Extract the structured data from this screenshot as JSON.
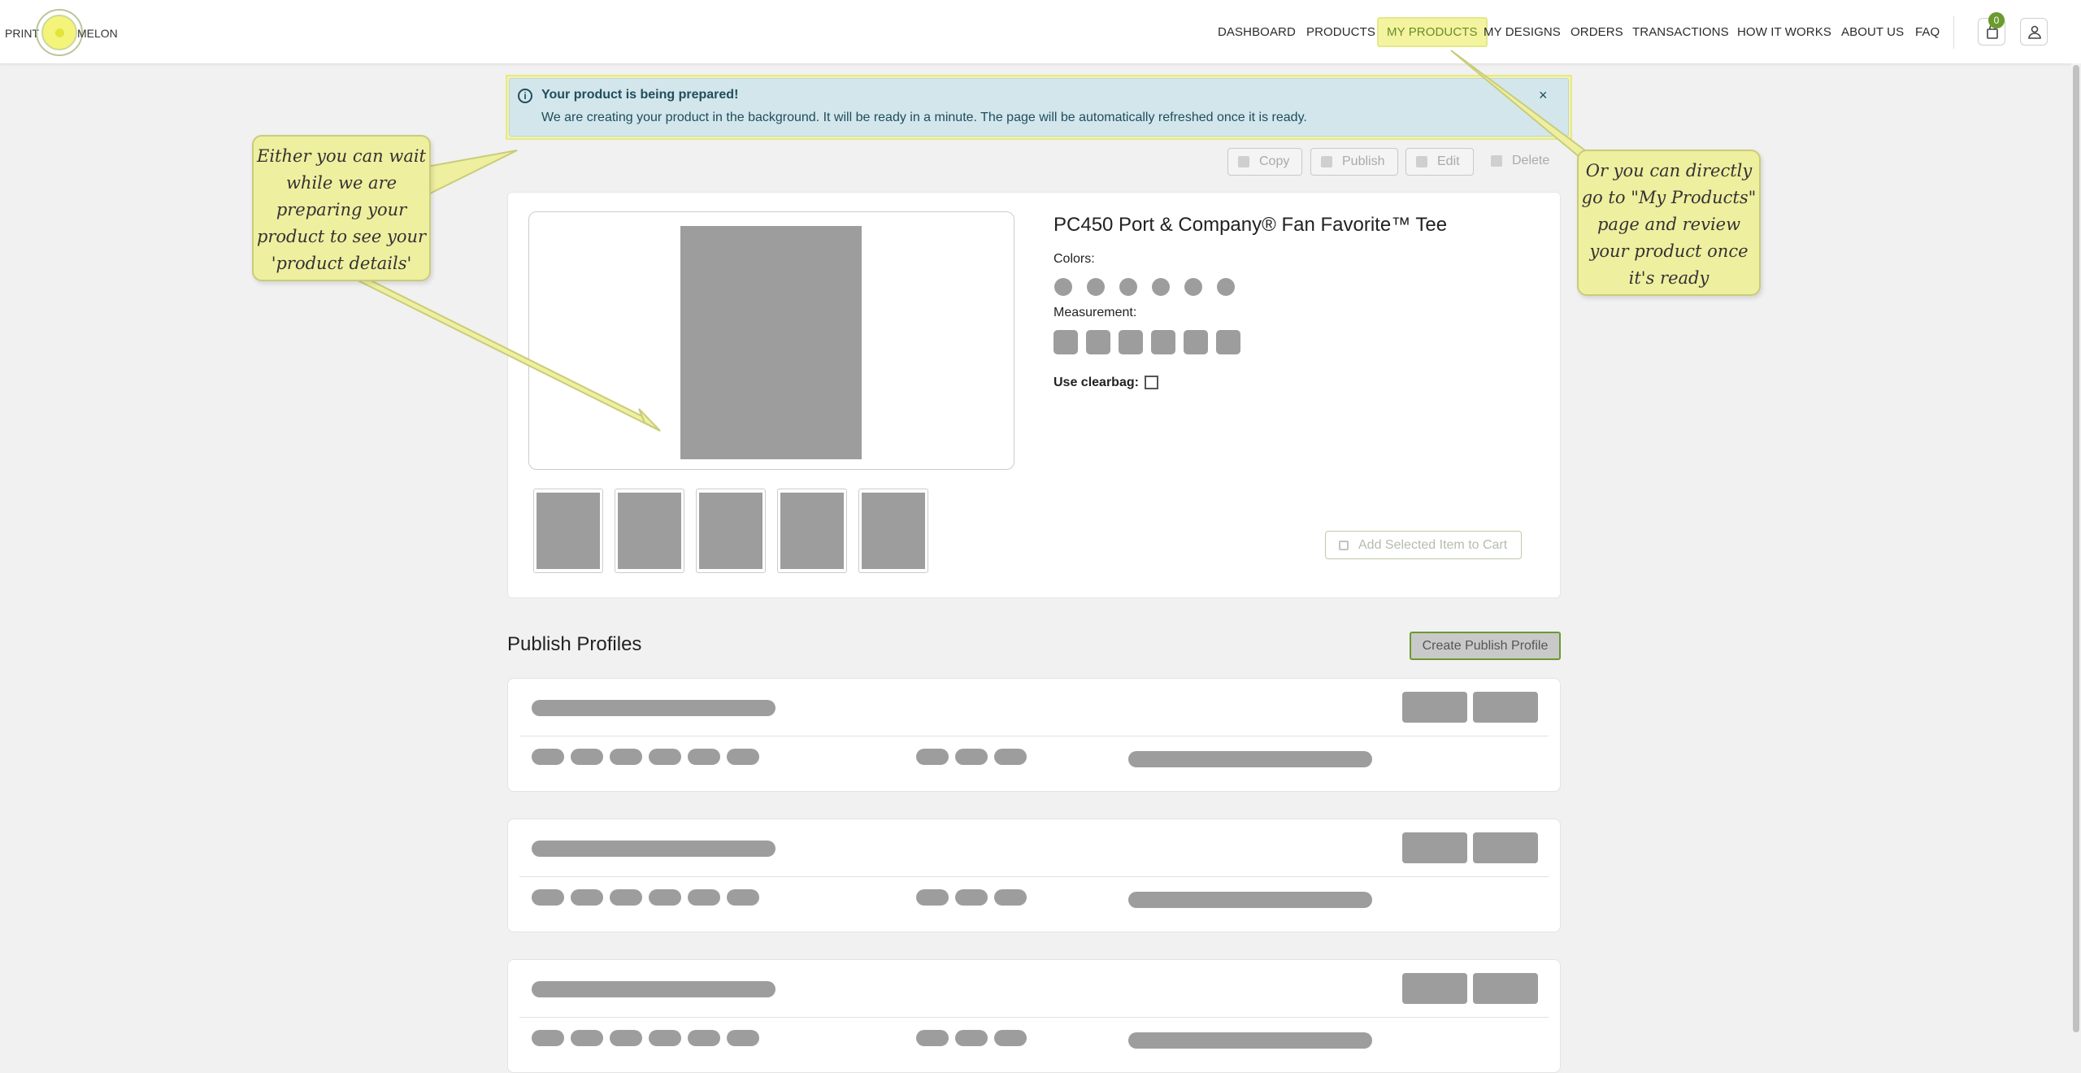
{
  "brand": {
    "left": "PRINT",
    "right": "MELON"
  },
  "nav": {
    "items": [
      {
        "label": "DASHBOARD"
      },
      {
        "label": "PRODUCTS"
      },
      {
        "label": "MY PRODUCTS"
      },
      {
        "label": "MY DESIGNS"
      },
      {
        "label": "ORDERS"
      },
      {
        "label": "TRANSACTIONS"
      },
      {
        "label": "HOW IT WORKS"
      },
      {
        "label": "ABOUT US"
      },
      {
        "label": "FAQ"
      }
    ],
    "cart_count": "0"
  },
  "alert": {
    "title": "Your product is being prepared!",
    "message": "We are creating your product in the background. It will be ready in a minute. The page will be automatically refreshed once it is ready.",
    "close": "×"
  },
  "actions": {
    "copy": "Copy",
    "publish": "Publish",
    "edit": "Edit",
    "delete": "Delete"
  },
  "product": {
    "title": "PC450 Port & Company® Fan Favorite™ Tee",
    "colors_label": "Colors:",
    "measurement_label": "Measurement:",
    "clearbag_label": "Use clearbag:",
    "add_to_cart": "Add Selected Item to Cart"
  },
  "publish_profiles": {
    "title": "Publish Profiles",
    "create_button": "Create Publish Profile"
  },
  "callouts": {
    "left": [
      "Either you can wait",
      "while we are",
      "preparing your",
      "product to see your",
      "'product details'"
    ],
    "right": [
      "Or you can directly",
      "go to \"My Products\"",
      "page and review",
      "your product once",
      "it's ready"
    ]
  },
  "colors": {
    "accent": "#6b9a2e",
    "highlight": "#f3f3a0",
    "placeholder": "#9d9d9d"
  }
}
